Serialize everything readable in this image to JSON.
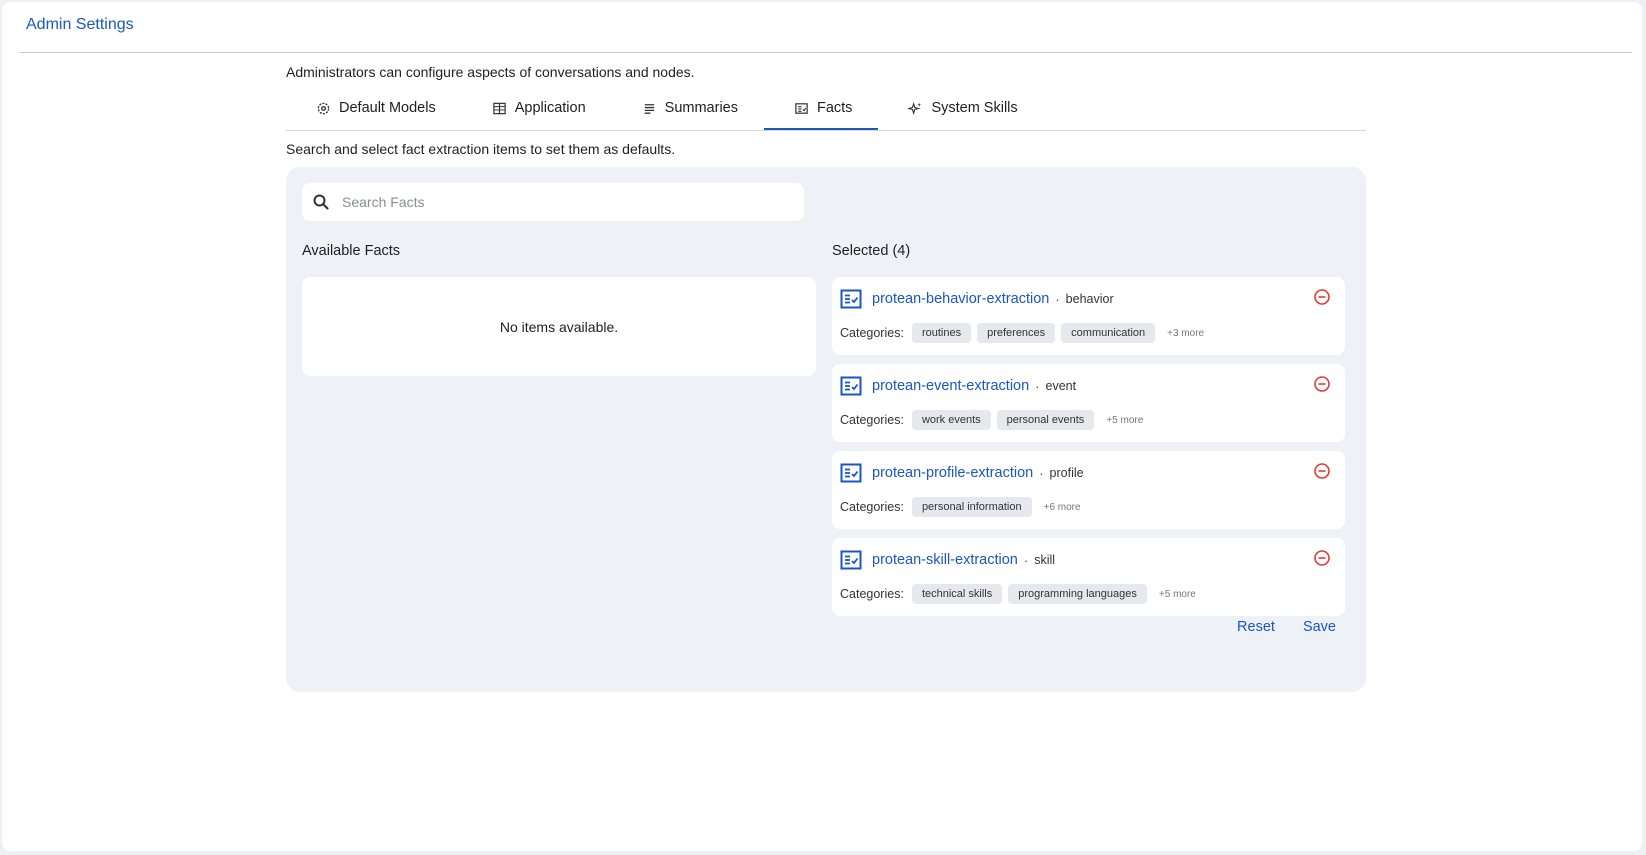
{
  "app": {
    "title": "Admin Settings"
  },
  "intro": "Administrators can configure aspects of conversations and nodes.",
  "tabs": [
    {
      "label": "Default Models",
      "icon": "gear-icon"
    },
    {
      "label": "Application",
      "icon": "columns-icon"
    },
    {
      "label": "Summaries",
      "icon": "lines-icon"
    },
    {
      "label": "Facts",
      "icon": "fact-card-icon",
      "active": true
    },
    {
      "label": "System Skills",
      "icon": "sparkle-icon"
    }
  ],
  "facts": {
    "subtitle": "Search and select fact extraction items to set them as defaults.",
    "search": {
      "placeholder": "Search Facts",
      "value": ""
    },
    "available_title": "Available Facts",
    "empty_text": "No items available.",
    "selected_title": "Selected (4)",
    "categories_label": "Categories:",
    "selected": [
      {
        "name": "protean-behavior-extraction",
        "type": "behavior",
        "categories": [
          "routines",
          "preferences",
          "communication"
        ],
        "more": "+3 more"
      },
      {
        "name": "protean-event-extraction",
        "type": "event",
        "categories": [
          "work events",
          "personal events"
        ],
        "more": "+5 more"
      },
      {
        "name": "protean-profile-extraction",
        "type": "profile",
        "categories": [
          "personal information"
        ],
        "more": "+6 more"
      },
      {
        "name": "protean-skill-extraction",
        "type": "skill",
        "categories": [
          "technical skills",
          "programming languages"
        ],
        "more": "+5 more"
      }
    ],
    "reset_label": "Reset",
    "save_label": "Save"
  },
  "colors": {
    "accent": "#1a56c4",
    "remove": "#e53935",
    "panel": "#eef1f6"
  }
}
